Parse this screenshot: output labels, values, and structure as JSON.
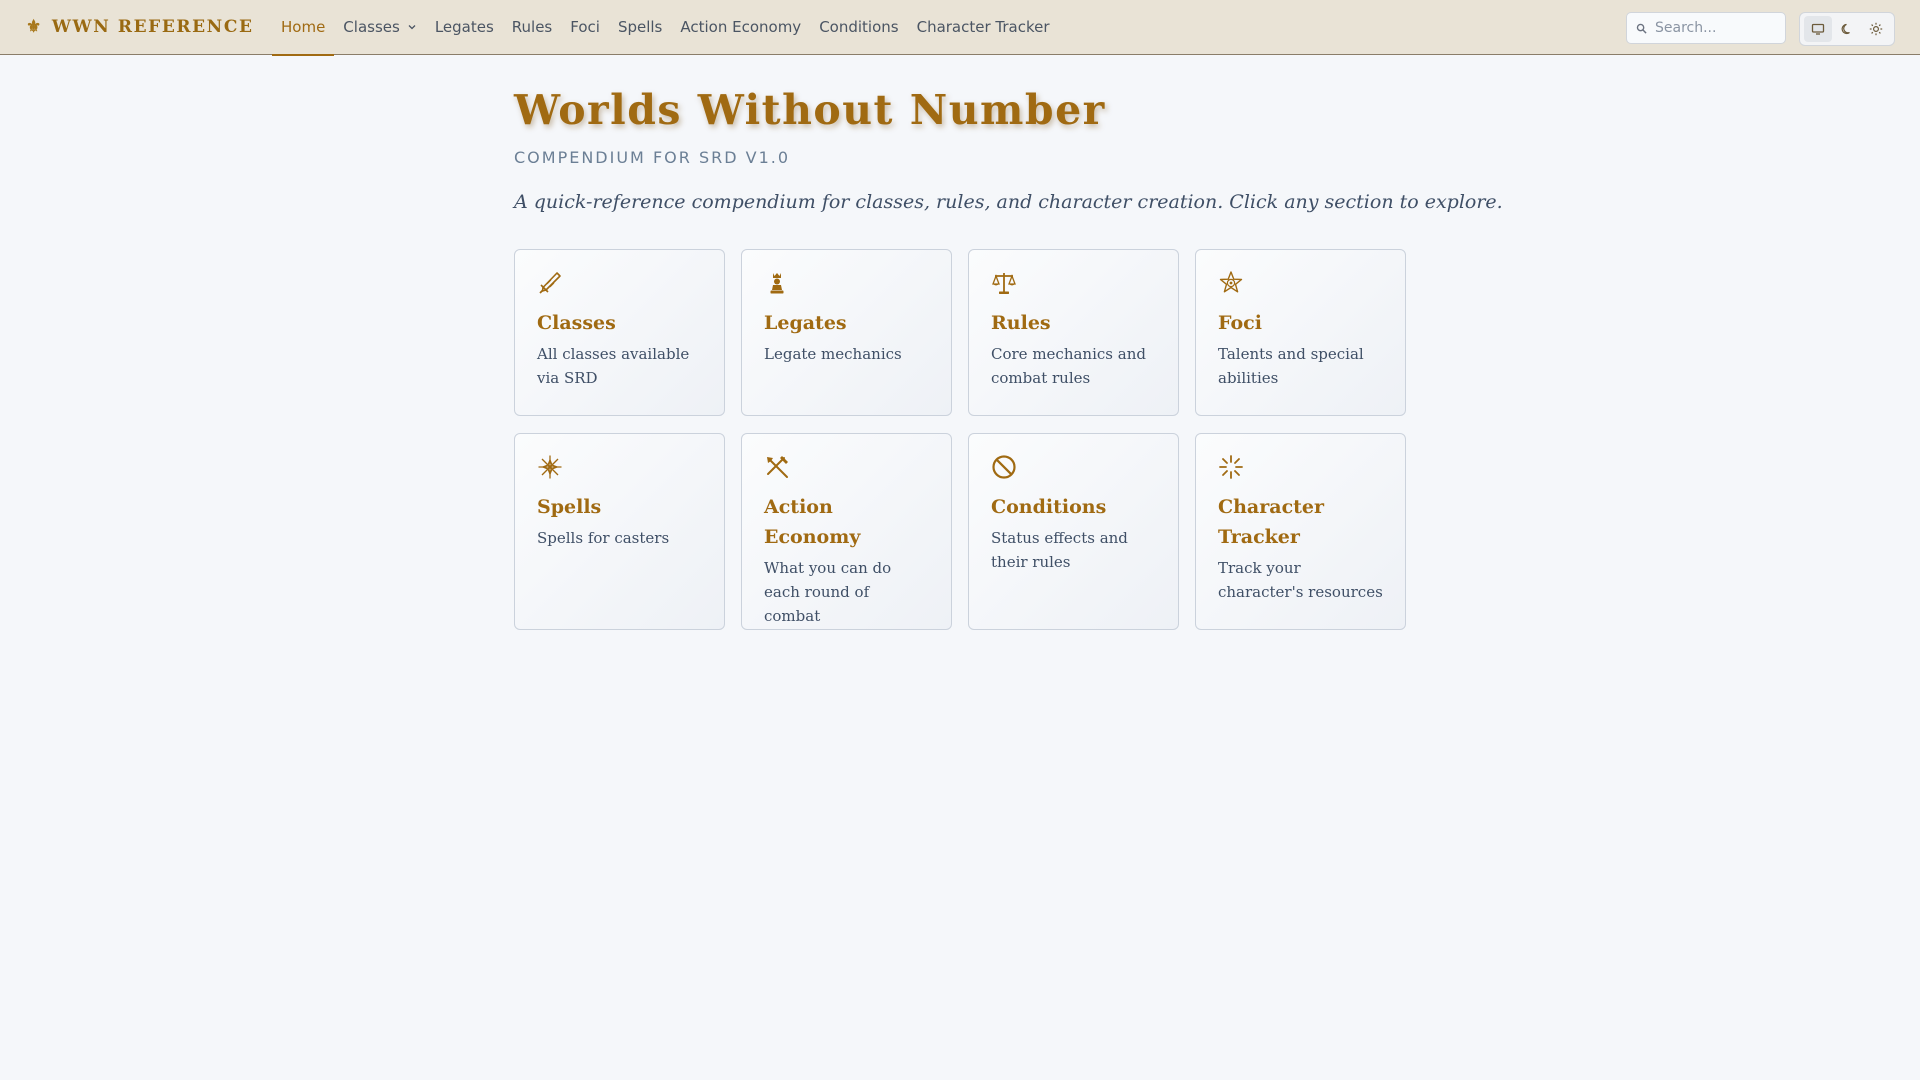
{
  "brand": {
    "name": "WWN REFERENCE",
    "icon": "fleur-de-lis-icon"
  },
  "nav": {
    "items": [
      {
        "label": "Home",
        "active": true
      },
      {
        "label": "Classes",
        "dropdown": true
      },
      {
        "label": "Legates"
      },
      {
        "label": "Rules"
      },
      {
        "label": "Foci"
      },
      {
        "label": "Spells"
      },
      {
        "label": "Action Economy"
      },
      {
        "label": "Conditions"
      },
      {
        "label": "Character Tracker"
      }
    ]
  },
  "search": {
    "placeholder": "Search..."
  },
  "theme": {
    "options": [
      "system",
      "dark",
      "light"
    ],
    "selected": "system"
  },
  "page": {
    "title": "Worlds Without Number",
    "subtitle": "COMPENDIUM FOR SRD V1.0",
    "intro": "A quick-reference compendium for classes, rules, and character creation. Click any section to explore."
  },
  "cards": [
    {
      "title": "Classes",
      "description": "All classes available via SRD",
      "icon": "sword-icon"
    },
    {
      "title": "Legates",
      "description": "Legate mechanics",
      "icon": "chess-king-icon"
    },
    {
      "title": "Rules",
      "description": "Core mechanics and combat rules",
      "icon": "scales-icon"
    },
    {
      "title": "Foci",
      "description": "Talents and special abilities",
      "icon": "star-emblem-icon"
    },
    {
      "title": "Spells",
      "description": "Spells for casters",
      "icon": "magic-star-icon"
    },
    {
      "title": "Action Economy",
      "description": "What you can do each round of combat",
      "icon": "crossed-tools-icon"
    },
    {
      "title": "Conditions",
      "description": "Status effects and their rules",
      "icon": "prohibited-icon"
    },
    {
      "title": "Character Tracker",
      "description": "Track your character's resources",
      "icon": "sparkle-icon"
    }
  ],
  "colors": {
    "accent": "#a06a12",
    "nav_bg": "#e9e3d6",
    "page_bg": "#f5f7fa"
  }
}
